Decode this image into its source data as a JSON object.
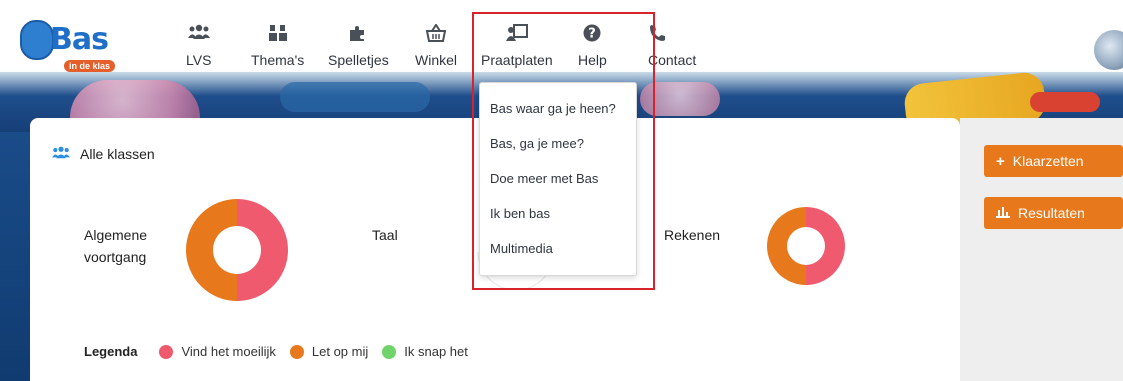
{
  "logo": {
    "name": "Bas",
    "tagline": "in de klas"
  },
  "nav": [
    {
      "label": "LVS",
      "icon": "users-icon"
    },
    {
      "label": "Thema's",
      "icon": "blocks-icon"
    },
    {
      "label": "Spelletjes",
      "icon": "puzzle-icon"
    },
    {
      "label": "Winkel",
      "icon": "basket-icon"
    },
    {
      "label": "Praatplaten",
      "icon": "presentation-icon"
    },
    {
      "label": "Help",
      "icon": "question-icon"
    },
    {
      "label": "Contact",
      "icon": "phone-icon"
    }
  ],
  "dropdown": {
    "items": [
      "Bas waar ga je heen?",
      "Bas, ga je mee?",
      "Doe meer met Bas",
      "Ik ben bas",
      "Multimedia"
    ]
  },
  "main": {
    "group_title": "Alle klassen",
    "metrics": [
      {
        "label_line1": "Algemene",
        "label_line2": "voortgang",
        "red_fraction": 0.5,
        "orange_fraction": 0.5
      },
      {
        "label_line1": "Taal",
        "label_line2": ""
      },
      {
        "label_line1": "Rekenen",
        "label_line2": "",
        "red_fraction": 0.5,
        "orange_fraction": 0.5
      }
    ],
    "legend": {
      "title": "Legenda",
      "items": [
        {
          "label": "Vind het moeilijk",
          "color": "#ef5a6f"
        },
        {
          "label": "Let op mij",
          "color": "#e8781c"
        },
        {
          "label": "Ik snap het",
          "color": "#6fd36a"
        }
      ]
    }
  },
  "side": {
    "klaarzetten_label": "Klaarzetten",
    "resultaten_label": "Resultaten"
  },
  "colors": {
    "accent": "#e8781c",
    "red": "#ef5a6f",
    "orange": "#e8781c",
    "green": "#6fd36a",
    "highlight": "#d9232a"
  }
}
